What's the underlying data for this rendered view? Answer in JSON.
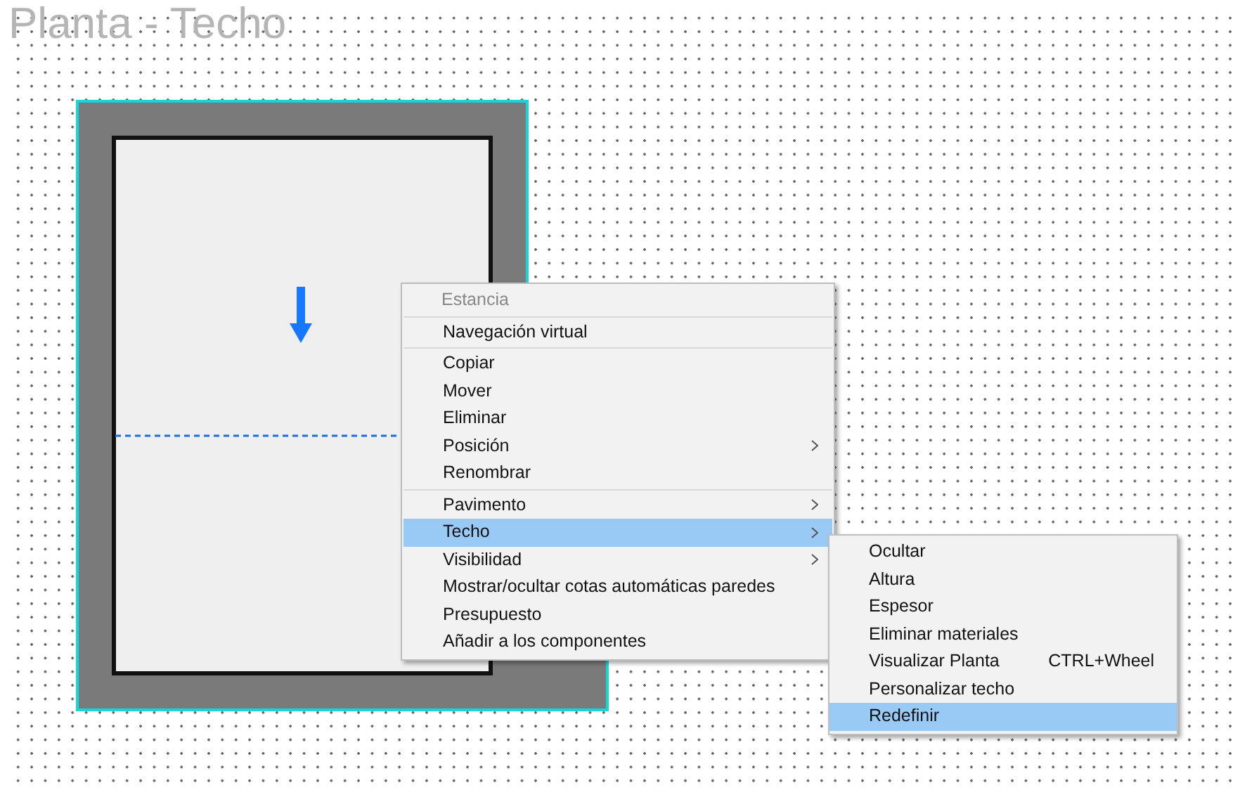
{
  "title": "Planta - Techo",
  "context_menu": {
    "groups": [
      [
        {
          "label": "Estancia",
          "disabled": true,
          "selected": false,
          "submenu": false
        }
      ],
      [
        {
          "label": "Navegación virtual",
          "disabled": false,
          "selected": false,
          "submenu": false
        }
      ],
      [
        {
          "label": "Copiar",
          "disabled": false,
          "selected": false,
          "submenu": false
        },
        {
          "label": "Mover",
          "disabled": false,
          "selected": false,
          "submenu": false
        },
        {
          "label": "Eliminar",
          "disabled": false,
          "selected": false,
          "submenu": false
        },
        {
          "label": "Posición",
          "disabled": false,
          "selected": false,
          "submenu": true
        },
        {
          "label": "Renombrar",
          "disabled": false,
          "selected": false,
          "submenu": false
        }
      ],
      [
        {
          "label": "Pavimento",
          "disabled": false,
          "selected": false,
          "submenu": true
        },
        {
          "label": "Techo",
          "disabled": false,
          "selected": true,
          "submenu": true
        },
        {
          "label": "Visibilidad",
          "disabled": false,
          "selected": false,
          "submenu": true
        },
        {
          "label": "Mostrar/ocultar cotas automáticas paredes",
          "disabled": false,
          "selected": false,
          "submenu": false
        },
        {
          "label": "Presupuesto",
          "disabled": false,
          "selected": false,
          "submenu": false
        },
        {
          "label": "Añadir a los componentes",
          "disabled": false,
          "selected": false,
          "submenu": false
        }
      ]
    ]
  },
  "submenu": {
    "items": [
      {
        "label": "Ocultar",
        "selected": false
      },
      {
        "label": "Altura",
        "selected": false
      },
      {
        "label": "Espesor",
        "selected": false
      },
      {
        "label": "Eliminar materiales",
        "selected": false
      },
      {
        "label": "Visualizar Planta",
        "shortcut": "CTRL+Wheel",
        "selected": false
      },
      {
        "label": "Personalizar techo",
        "selected": false
      },
      {
        "label": "Redefinir",
        "selected": true
      }
    ]
  }
}
